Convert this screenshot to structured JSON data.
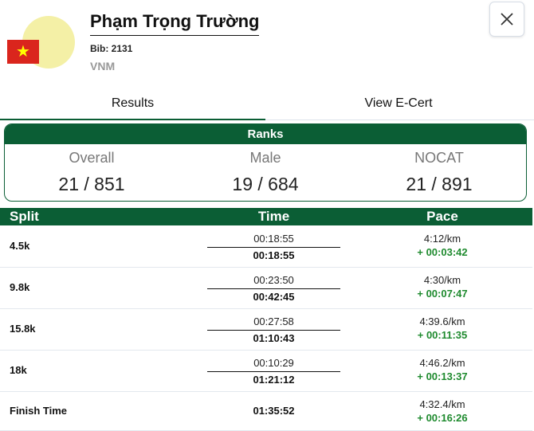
{
  "athlete": {
    "name": "Phạm Trọng Trường",
    "bib": "Bib: 2131",
    "country": "VNM",
    "flag_star": "★",
    "colors": {
      "flag_red": "#da251d",
      "flag_star": "#ffff00",
      "avatar_bg": "#f4f0a6"
    }
  },
  "header": {
    "close_icon": "close-icon"
  },
  "tabs": [
    {
      "label": "Results",
      "active": true
    },
    {
      "label": "View E-Cert",
      "active": false
    }
  ],
  "ranks": {
    "title": "Ranks",
    "items": [
      {
        "label": "Overall",
        "value": "21 / 851"
      },
      {
        "label": "Male",
        "value": "19 / 684"
      },
      {
        "label": "NOCAT",
        "value": "21 / 891"
      }
    ]
  },
  "splits": {
    "headers": {
      "split": "Split",
      "time": "Time",
      "pace": "Pace"
    },
    "rows": [
      {
        "label": "4.5k",
        "split_time": "00:18:55",
        "cum_time": "00:18:55",
        "pace": "4:12/km",
        "gap": "+ 00:03:42"
      },
      {
        "label": "9.8k",
        "split_time": "00:23:50",
        "cum_time": "00:42:45",
        "pace": "4:30/km",
        "gap": "+ 00:07:47"
      },
      {
        "label": "15.8k",
        "split_time": "00:27:58",
        "cum_time": "01:10:43",
        "pace": "4:39.6/km",
        "gap": "+ 00:11:35"
      },
      {
        "label": "18k",
        "split_time": "00:10:29",
        "cum_time": "01:21:12",
        "pace": "4:46.2/km",
        "gap": "+ 00:13:37"
      }
    ],
    "finish": {
      "label": "Finish Time",
      "time": "01:35:52",
      "pace": "4:32.4/km",
      "gap": "+ 00:16:26"
    }
  },
  "theme": {
    "primary": "#0b5e35",
    "gain": "#1e8a2e"
  }
}
